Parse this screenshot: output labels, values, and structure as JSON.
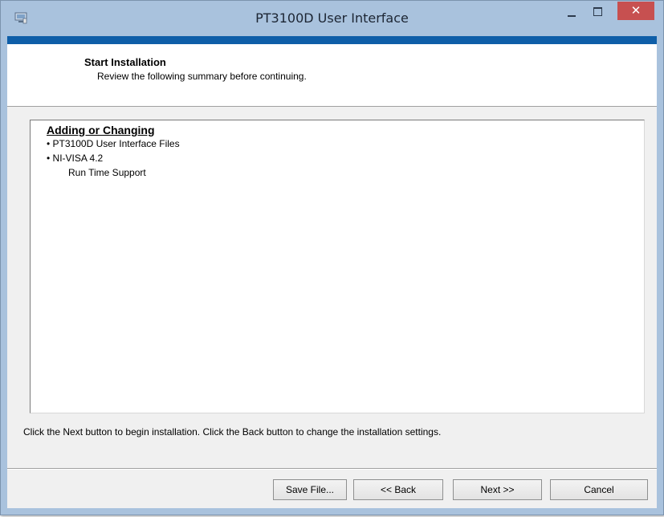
{
  "window": {
    "title": "PT3100D User Interface",
    "minimize_glyph": "",
    "maximize_glyph": "",
    "close_glyph": "✕",
    "accent_color": "#0e5ea8",
    "close_color": "#c75050"
  },
  "header": {
    "title": "Start Installation",
    "subtitle": "Review the following summary before continuing."
  },
  "summary": {
    "heading": "Adding or Changing",
    "items": [
      "• PT3100D User Interface Files",
      "• NI-VISA 4.2"
    ],
    "sub_items": [
      "Run Time Support"
    ]
  },
  "instructions": "Click the Next button to begin installation.  Click the Back button to change the installation settings.",
  "buttons": {
    "save": "Save File...",
    "back": "<< Back",
    "next": "Next >>",
    "cancel": "Cancel"
  }
}
